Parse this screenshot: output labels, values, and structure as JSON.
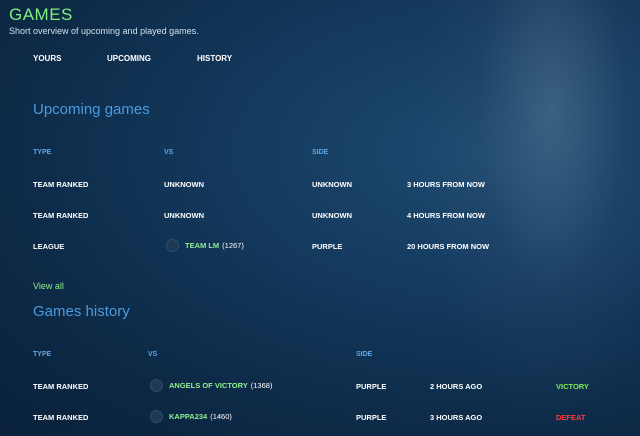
{
  "header": {
    "title": "GAMES",
    "subtitle": "Short overview of upcoming and played games."
  },
  "nav": {
    "tabs": [
      "YOURS",
      "UPCOMING",
      "HISTORY"
    ]
  },
  "upcoming": {
    "title": "Upcoming games",
    "columns": [
      "TYPE",
      "VS",
      "SIDE"
    ],
    "rows": [
      {
        "type": "TEAM RANKED",
        "vs": "UNKNOWN",
        "side": "UNKNOWN",
        "time": "3 HOURS FROM NOW"
      },
      {
        "type": "TEAM RANKED",
        "vs": "UNKNOWN",
        "side": "UNKNOWN",
        "time": "4 HOURS FROM NOW"
      },
      {
        "type": "LEAGUE",
        "vs_team": "TEAM LM",
        "vs_rating": "(1267)",
        "side": "PURPLE",
        "time": "20 HOURS FROM NOW"
      }
    ],
    "view_all": "View all"
  },
  "history": {
    "title": "Games history",
    "columns": [
      "TYPE",
      "VS",
      "SIDE"
    ],
    "rows": [
      {
        "type": "TEAM RANKED",
        "vs_team": "ANGELS OF VICTORY",
        "vs_rating": "(1368)",
        "side": "PURPLE",
        "time": "2 HOURS AGO",
        "result": "VICTORY"
      },
      {
        "type": "TEAM RANKED",
        "vs_team": "KAPPA234",
        "vs_rating": "(1460)",
        "side": "PURPLE",
        "time": "3 HOURS AGO",
        "result": "DEFEAT"
      }
    ]
  },
  "colors": {
    "accent_green": "#7ef07e",
    "heading_blue": "#4a9be0",
    "victory": "#7fea54",
    "defeat": "#ff3b3b"
  }
}
